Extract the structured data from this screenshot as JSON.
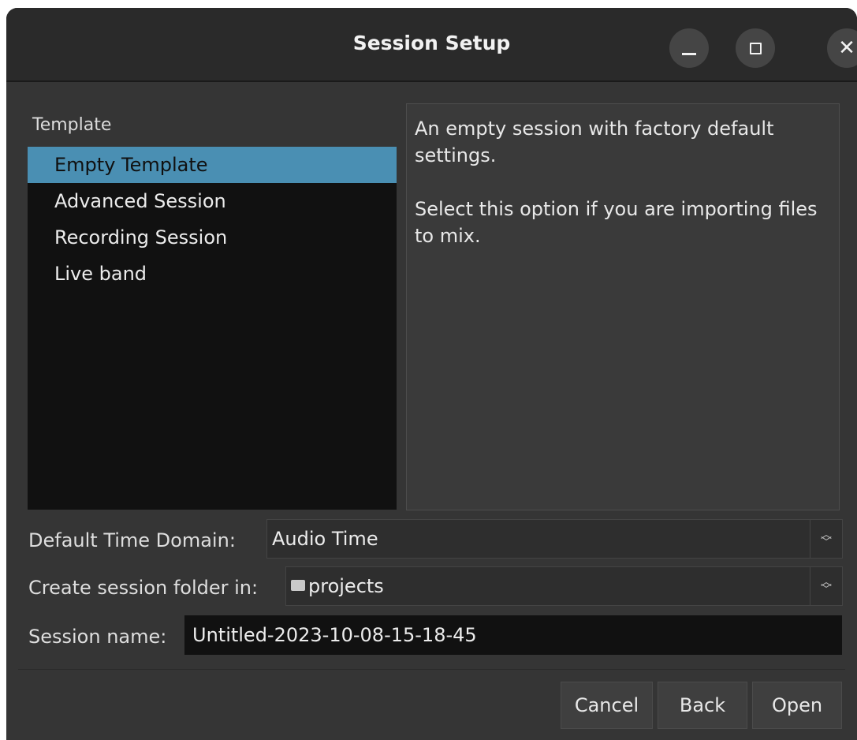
{
  "window": {
    "title": "Session Setup",
    "controls": {
      "minimize": "minimize-icon",
      "maximize": "maximize-icon",
      "close": "close-icon"
    }
  },
  "template": {
    "header": "Template",
    "items": [
      {
        "label": "Empty Template",
        "selected": true
      },
      {
        "label": "Advanced Session",
        "selected": false
      },
      {
        "label": "Recording Session",
        "selected": false
      },
      {
        "label": "Live band",
        "selected": false
      }
    ]
  },
  "description": {
    "para1": "An empty session with factory default settings.",
    "para2": "Select this option if you are importing files to mix."
  },
  "time_domain": {
    "label": "Default Time Domain:",
    "value": "Audio Time"
  },
  "session_folder": {
    "label": "Create session folder in:",
    "value": "projects",
    "icon": "folder-icon"
  },
  "session_name": {
    "label": "Session name:",
    "value": "Untitled-2023-10-08-15-18-45"
  },
  "buttons": {
    "cancel": "Cancel",
    "back": "Back",
    "open": "Open"
  },
  "colors": {
    "selection": "#4a8fb3",
    "background": "#353535",
    "list_background": "#111111"
  }
}
